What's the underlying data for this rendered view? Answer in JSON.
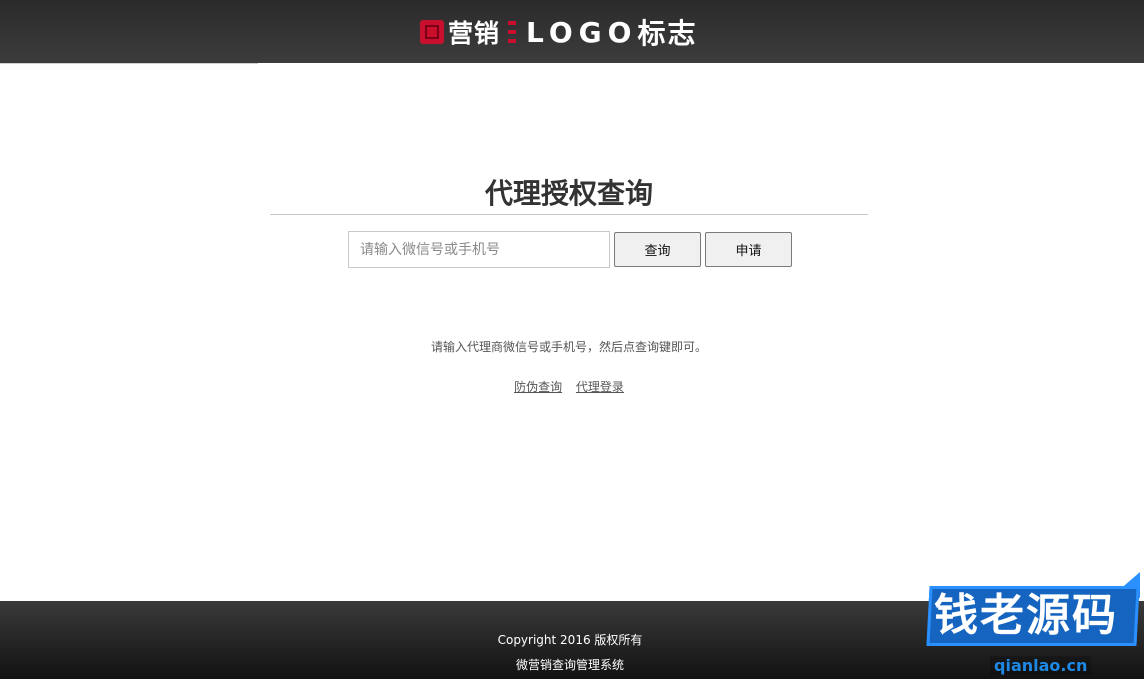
{
  "header": {
    "logo_cn": "营销",
    "logo_en": "LOGO",
    "logo_cn2": "标志",
    "brand_color": "#c8102e"
  },
  "main": {
    "title": "代理授权查询",
    "search_placeholder": "请输入微信号或手机号",
    "search_value": "",
    "query_button": "查询",
    "apply_button": "申请",
    "hint": "请输入代理商微信号或手机号，然后点查询键即可。",
    "links": [
      "防伪查询",
      "代理登录"
    ]
  },
  "footer": {
    "copyright": "Copyright 2016 版权所有",
    "system_name": "微营销查询管理系统"
  },
  "watermark": {
    "text": "钱老源码",
    "url": "qianlao.cn",
    "color": "#1565c0"
  }
}
